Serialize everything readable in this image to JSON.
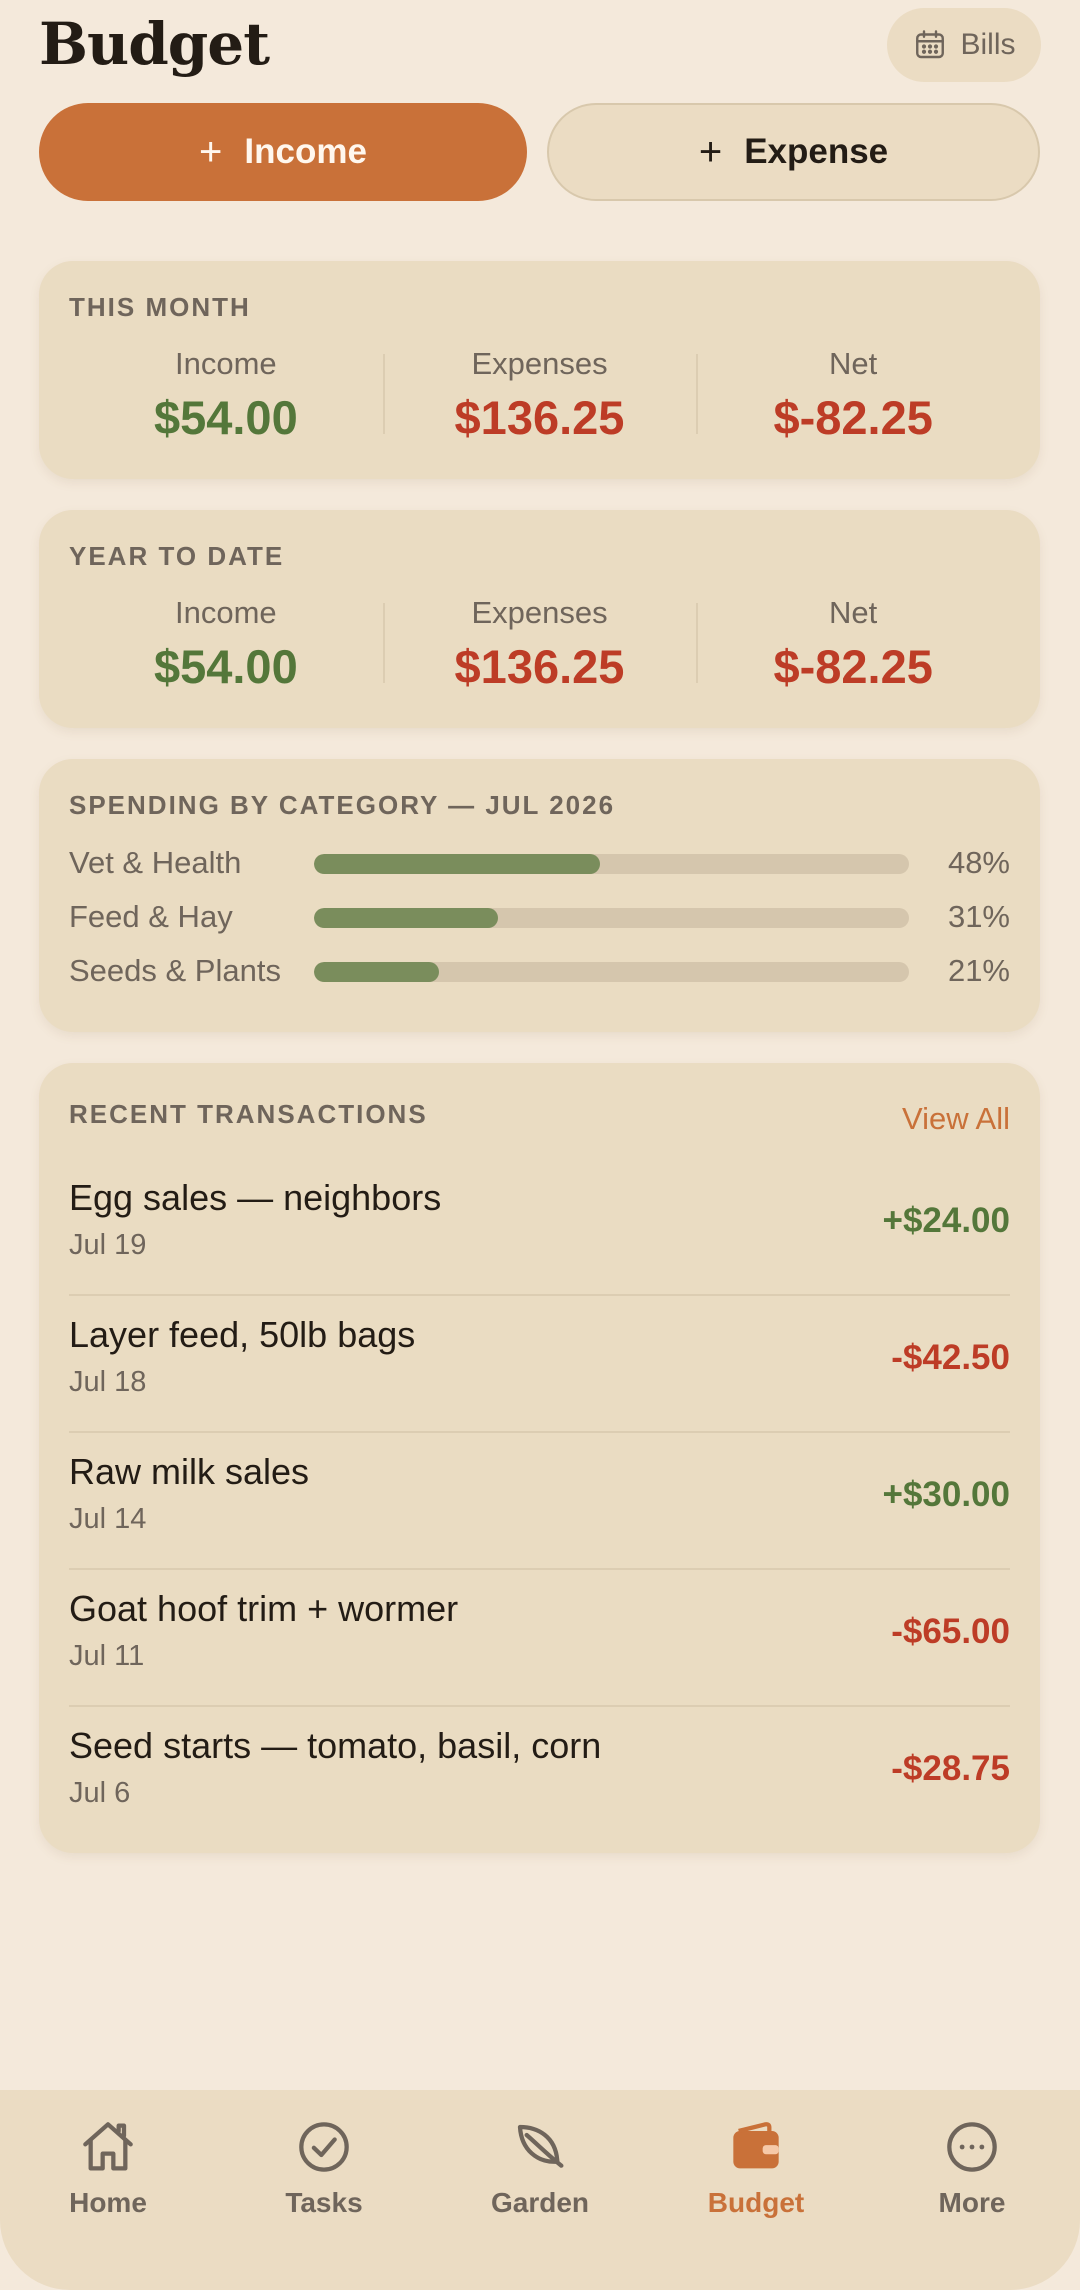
{
  "header": {
    "title": "Budget",
    "bills_label": "Bills",
    "bills_icon": "calendar-icon"
  },
  "actions": {
    "income_label": "Income",
    "expense_label": "Expense",
    "plus_glyph": "+"
  },
  "this_month": {
    "heading": "THIS MONTH",
    "income_label": "Income",
    "income_value": "$54.00",
    "expenses_label": "Expenses",
    "expenses_value": "$136.25",
    "net_label": "Net",
    "net_value": "$-82.25"
  },
  "year_to_date": {
    "heading": "YEAR TO DATE",
    "income_label": "Income",
    "income_value": "$54.00",
    "expenses_label": "Expenses",
    "expenses_value": "$136.25",
    "net_label": "Net",
    "net_value": "$-82.25"
  },
  "spending": {
    "heading": "SPENDING BY CATEGORY — JUL 2026",
    "categories": [
      {
        "label": "Vet & Health",
        "pct_label": "48%",
        "fraction": 0.48
      },
      {
        "label": "Feed & Hay",
        "pct_label": "31%",
        "fraction": 0.31
      },
      {
        "label": "Seeds & Plants",
        "pct_label": "21%",
        "fraction": 0.21
      }
    ]
  },
  "transactions": {
    "heading": "RECENT TRANSACTIONS",
    "view_all_label": "View All",
    "items": [
      {
        "title": "Egg sales — neighbors",
        "date": "Jul 19",
        "amount": "+$24.00",
        "type": "income"
      },
      {
        "title": "Layer feed, 50lb bags",
        "date": "Jul 18",
        "amount": "-$42.50",
        "type": "expense"
      },
      {
        "title": "Raw milk sales",
        "date": "Jul 14",
        "amount": "+$30.00",
        "type": "income"
      },
      {
        "title": "Goat hoof trim + wormer",
        "date": "Jul 11",
        "amount": "-$65.00",
        "type": "expense"
      },
      {
        "title": "Seed starts — tomato, basil, corn",
        "date": "Jul 6",
        "amount": "-$28.75",
        "type": "expense"
      }
    ]
  },
  "nav": {
    "items": [
      {
        "label": "Home",
        "icon": "home-icon",
        "active": false
      },
      {
        "label": "Tasks",
        "icon": "check-circle-icon",
        "active": false
      },
      {
        "label": "Garden",
        "icon": "leaf-icon",
        "active": false
      },
      {
        "label": "Budget",
        "icon": "wallet-icon",
        "active": true
      },
      {
        "label": "More",
        "icon": "more-icon",
        "active": false
      }
    ]
  },
  "colors": {
    "background": "#f4e9db",
    "card": "#eadcc2",
    "accent": "#c97139",
    "positive": "#54773a",
    "negative": "#bd3c26",
    "bar_fill": "#7a8d5c",
    "bar_track": "#d5c6ad"
  }
}
